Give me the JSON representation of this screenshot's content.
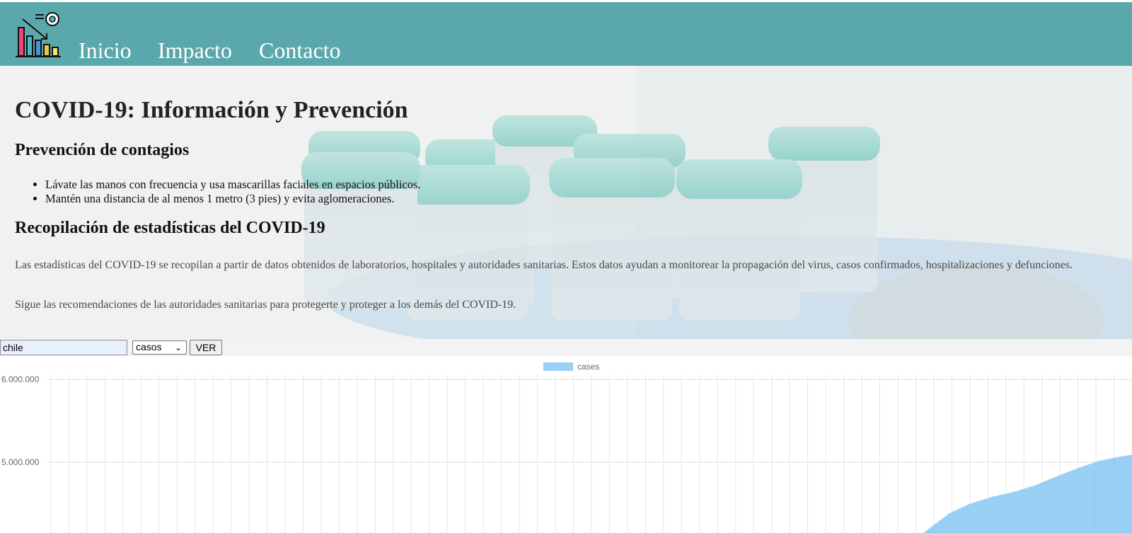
{
  "nav": {
    "logo_icon": "chart-gear-logo-icon",
    "links": [
      "Inicio",
      "Impacto",
      "Contacto"
    ]
  },
  "hero": {
    "title": "COVID-19: Información y Prevención",
    "prevention_heading": "Prevención de contagios",
    "bullets": [
      "Lávate las manos con frecuencia y usa mascarillas faciales en espacios públicos.",
      "Mantén una distancia de al menos 1 metro (3 pies) y evita aglomeraciones."
    ],
    "stats_heading": "Recopilación de estadísticas del COVID-19",
    "stats_paragraph": "Las estadísticas del COVID-19 se recopilan a partir de datos obtenidos de laboratorios, hospitales y autoridades sanitarias. Estos datos ayudan a monitorear la propagación del virus, casos confirmados, hospitalizaciones y defunciones.",
    "advice_paragraph": "Sigue las recomendaciones de las autoridades sanitarias para protegerte y proteger a los demás del COVID-19."
  },
  "controls": {
    "country_value": "chile",
    "type_selected": "casos",
    "view_button": "VER"
  },
  "colors": {
    "navbar": "#5aa8ac",
    "bar_fill": "#9ad0f5",
    "bar_border": "#36a2eb"
  },
  "chart_data": {
    "type": "bar",
    "legend": "cases",
    "legend_placement": "top-center",
    "y_ticks": [
      "6.000.000",
      "5.000.000"
    ],
    "y_tick_values": [
      6000000,
      5000000
    ],
    "ylim_visible": [
      4130000,
      6000000
    ],
    "grid": true,
    "series": [
      {
        "name": "cases",
        "points": [
          [
            0.0,
            0
          ],
          [
            0.8,
            0
          ],
          [
            0.805,
            4130000
          ],
          [
            0.815,
            4230000
          ],
          [
            0.83,
            4380000
          ],
          [
            0.85,
            4500000
          ],
          [
            0.87,
            4580000
          ],
          [
            0.89,
            4640000
          ],
          [
            0.91,
            4720000
          ],
          [
            0.93,
            4830000
          ],
          [
            0.95,
            4930000
          ],
          [
            0.97,
            5020000
          ],
          [
            0.99,
            5070000
          ],
          [
            1.0,
            5090000
          ]
        ]
      }
    ]
  }
}
